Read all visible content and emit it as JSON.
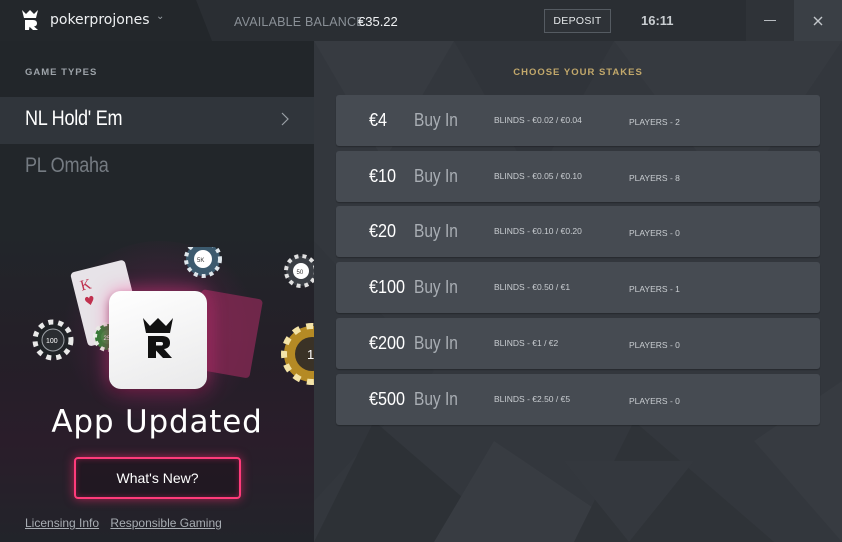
{
  "titlebar": {
    "username": "pokerprojones",
    "balance_label": "AVAILABLE BALANCE:",
    "balance_value": "€35.22",
    "deposit_label": "DEPOSIT",
    "time": "16:11"
  },
  "sidebar": {
    "section_label": "GAME TYPES",
    "games": [
      {
        "label": "NL Hold' Em",
        "selected": true
      },
      {
        "label": "PL Omaha",
        "selected": false
      }
    ]
  },
  "promo": {
    "title": "App Updated",
    "button_label": "What's New?",
    "accent_color": "#ff3b7a"
  },
  "footer_links": {
    "licensing": "Licensing Info",
    "responsible": "Responsible Gaming"
  },
  "stakes": {
    "section_label": "CHOOSE YOUR STAKES",
    "rows": [
      {
        "amount": "€4",
        "action": "Buy In",
        "blinds": "BLINDS - €0.02 / €0.04",
        "players": "PLAYERS - 2"
      },
      {
        "amount": "€10",
        "action": "Buy In",
        "blinds": "BLINDS - €0.05 / €0.10",
        "players": "PLAYERS - 8"
      },
      {
        "amount": "€20",
        "action": "Buy In",
        "blinds": "BLINDS - €0.10 / €0.20",
        "players": "PLAYERS - 0"
      },
      {
        "amount": "€100",
        "action": "Buy In",
        "blinds": "BLINDS - €0.50 / €1",
        "players": "PLAYERS - 1"
      },
      {
        "amount": "€200",
        "action": "Buy In",
        "blinds": "BLINDS - €1 / €2",
        "players": "PLAYERS - 0"
      },
      {
        "amount": "€500",
        "action": "Buy In",
        "blinds": "BLINDS - €2.50 / €5",
        "players": "PLAYERS - 0"
      }
    ]
  }
}
